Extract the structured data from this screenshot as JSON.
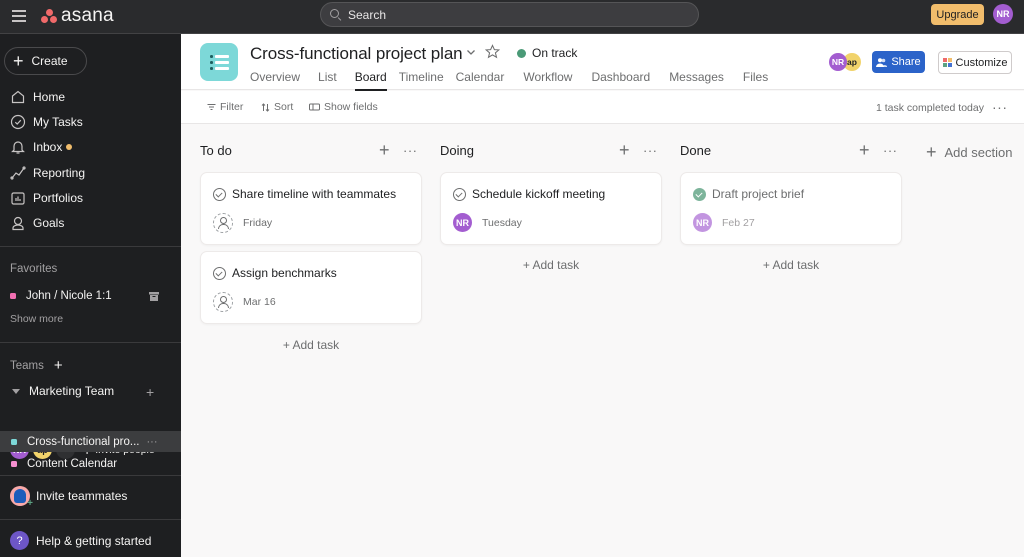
{
  "topbar": {
    "logo_text": "asana",
    "search_placeholder": "Search",
    "upgrade_label": "Upgrade",
    "user_initials": "NR"
  },
  "sidebar": {
    "create_label": "Create",
    "nav": [
      {
        "label": "Home",
        "icon": "home-icon"
      },
      {
        "label": "My Tasks",
        "icon": "check-circle-icon"
      },
      {
        "label": "Inbox",
        "icon": "bell-icon",
        "has_notification": true
      },
      {
        "label": "Reporting",
        "icon": "reporting-icon"
      },
      {
        "label": "Portfolios",
        "icon": "portfolio-icon"
      },
      {
        "label": "Goals",
        "icon": "goals-icon"
      }
    ],
    "favorites_label": "Favorites",
    "favorites": [
      {
        "label": "John / Nicole 1:1",
        "color": "#f26fb2"
      }
    ],
    "show_more_label": "Show more",
    "teams_label": "Teams",
    "team": {
      "name": "Marketing Team",
      "members": [
        {
          "initials": "NR",
          "color": "#a35dd0"
        },
        {
          "initials": "ap",
          "color": "#f1d36b"
        },
        {
          "initials": "",
          "color": "#2f3032"
        }
      ],
      "invite_label": "Invite people"
    },
    "projects": [
      {
        "label": "Cross-functional pro...",
        "color": "#7dd8d8",
        "active": true
      },
      {
        "label": "Content Calendar",
        "color": "#f48fd0",
        "active": false
      }
    ],
    "invite_teammates_label": "Invite teammates",
    "help_label": "Help & getting started"
  },
  "header": {
    "title": "Cross-functional project plan",
    "status": "On track",
    "status_color": "#4a9a77",
    "tabs": [
      "Overview",
      "List",
      "Board",
      "Timeline",
      "Calendar",
      "Workflow",
      "Dashboard",
      "Messages",
      "Files"
    ],
    "active_tab": "Board",
    "members": [
      {
        "initials": "NR",
        "color": "#a35dd0"
      },
      {
        "initials": "ap",
        "color": "#f1d36b"
      }
    ],
    "share_label": "Share",
    "customize_label": "Customize"
  },
  "toolbar": {
    "filter_label": "Filter",
    "sort_label": "Sort",
    "show_fields_label": "Show fields",
    "completed_text": "1 task completed today"
  },
  "board": {
    "add_task_label": "+ Add task",
    "add_section_label": "Add section",
    "columns": [
      {
        "title": "To do",
        "cards": [
          {
            "title": "Share timeline with teammates",
            "assignee": "",
            "due": "Friday",
            "done": false
          },
          {
            "title": "Assign benchmarks",
            "assignee": "",
            "due": "Mar 16",
            "done": false
          }
        ]
      },
      {
        "title": "Doing",
        "cards": [
          {
            "title": "Schedule kickoff meeting",
            "assignee": "NR",
            "due": "Tuesday",
            "done": false
          }
        ]
      },
      {
        "title": "Done",
        "cards": [
          {
            "title": "Draft project brief",
            "assignee": "NR",
            "due": "Feb 27",
            "done": true
          }
        ]
      }
    ]
  }
}
